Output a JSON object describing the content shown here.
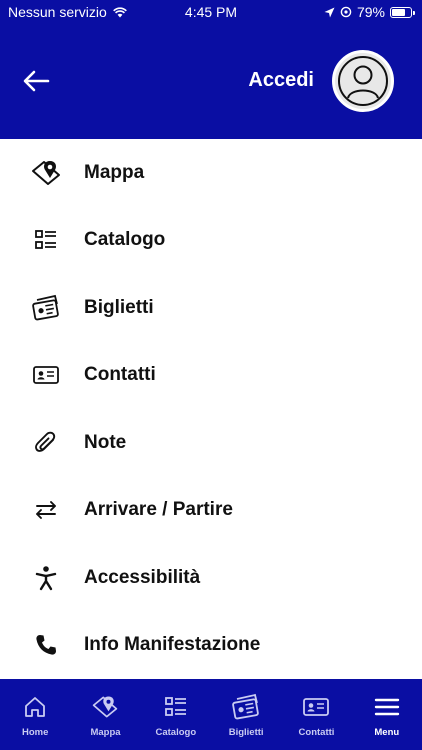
{
  "status_bar": {
    "carrier": "Nessun servizio",
    "time": "4:45 PM",
    "battery": "79%",
    "battery_level": 0.79
  },
  "header": {
    "login_label": "Accedi",
    "back_icon": "arrow-left-icon",
    "avatar_icon": "user-avatar-icon"
  },
  "menu": {
    "items": [
      {
        "label": "Mappa",
        "icon": "map-pin-icon"
      },
      {
        "label": "Catalogo",
        "icon": "list-icon"
      },
      {
        "label": "Biglietti",
        "icon": "tickets-icon"
      },
      {
        "label": "Contatti",
        "icon": "contact-card-icon"
      },
      {
        "label": "Note",
        "icon": "paperclip-icon"
      },
      {
        "label": "Arrivare / Partire",
        "icon": "swap-arrows-icon"
      },
      {
        "label": "Accessibilità",
        "icon": "accessibility-icon"
      },
      {
        "label": "Info Manifestazione",
        "icon": "phone-icon"
      }
    ]
  },
  "tabbar": {
    "tabs": [
      {
        "label": "Home",
        "icon": "home-icon"
      },
      {
        "label": "Mappa",
        "icon": "map-pin-icon"
      },
      {
        "label": "Catalogo",
        "icon": "list-icon"
      },
      {
        "label": "Biglietti",
        "icon": "tickets-icon"
      },
      {
        "label": "Contatti",
        "icon": "contact-card-icon"
      },
      {
        "label": "Menu",
        "icon": "hamburger-icon"
      }
    ],
    "active": "Menu"
  },
  "colors": {
    "brand": "#0a0ea3",
    "tab_inactive": "#c9cbf2",
    "tab_active": "#ffffff"
  }
}
